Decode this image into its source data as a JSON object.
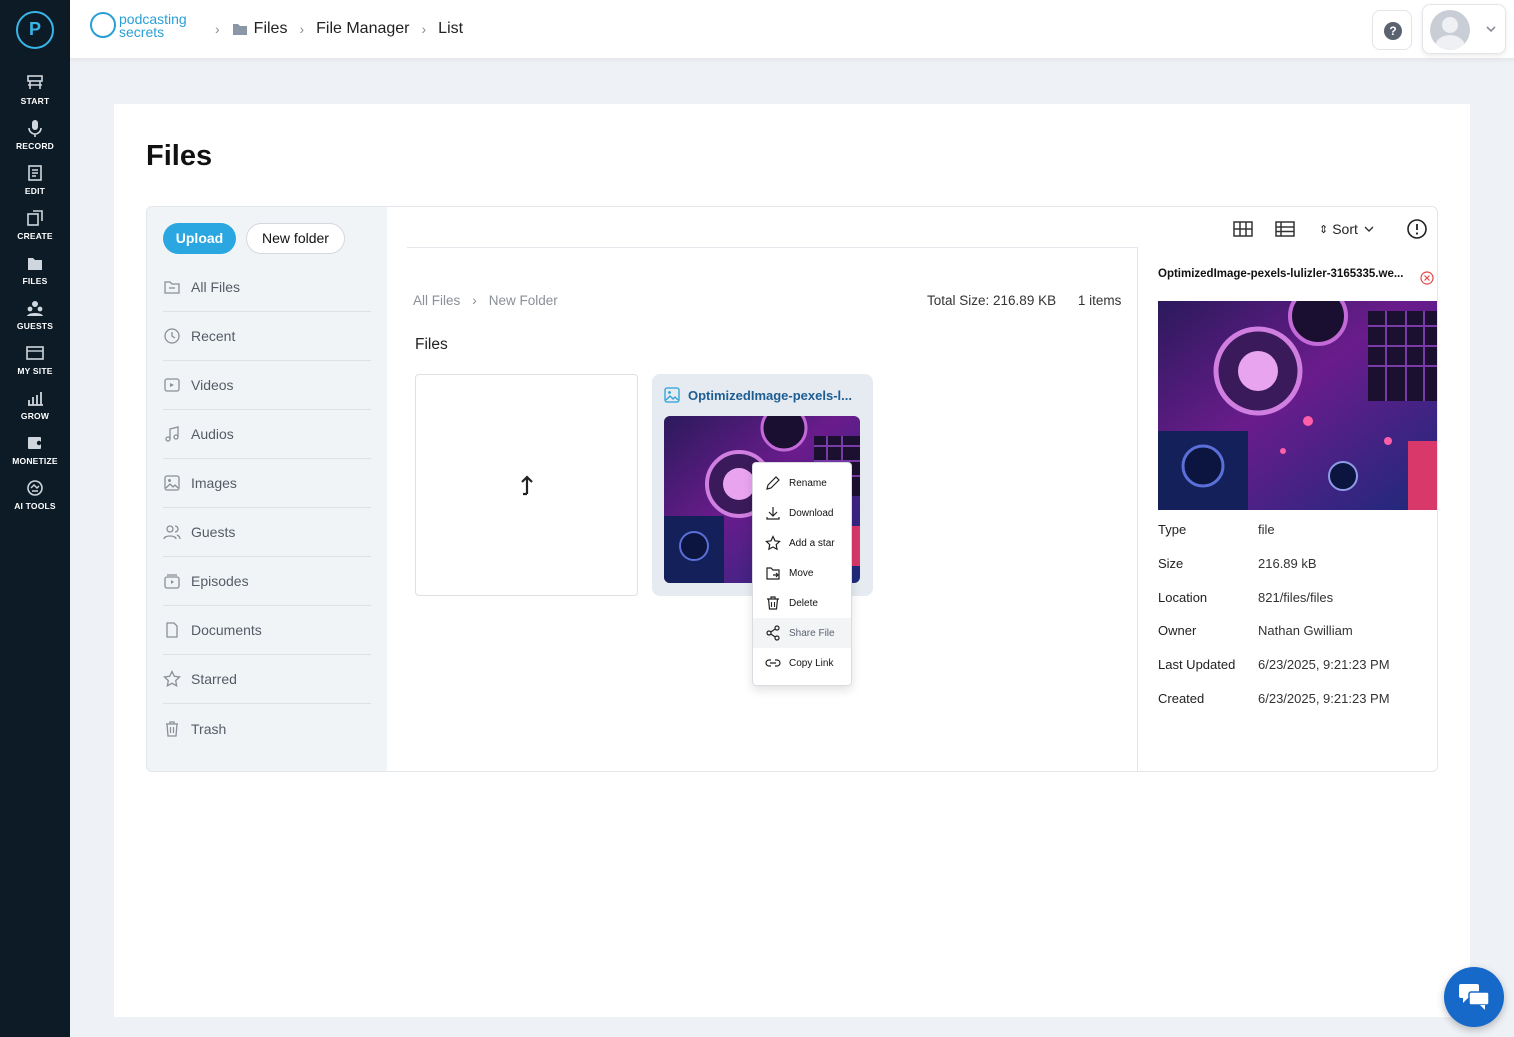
{
  "rail": {
    "logo_letter": "P",
    "items": [
      {
        "label": "START",
        "icon": "start-icon"
      },
      {
        "label": "RECORD",
        "icon": "microphone-icon"
      },
      {
        "label": "EDIT",
        "icon": "edit-icon"
      },
      {
        "label": "CREATE",
        "icon": "create-icon"
      },
      {
        "label": "FILES",
        "icon": "files-icon"
      },
      {
        "label": "GUESTS",
        "icon": "guests-icon"
      },
      {
        "label": "MY SITE",
        "icon": "my-site-icon"
      },
      {
        "label": "GROW",
        "icon": "grow-icon"
      },
      {
        "label": "MONETIZE",
        "icon": "monetize-icon"
      },
      {
        "label": "AI TOOLS",
        "icon": "ai-tools-icon"
      }
    ]
  },
  "header": {
    "brand_line1": "podcasting",
    "brand_line2": "secrets",
    "breadcrumb": [
      "Files",
      "File Manager",
      "List"
    ],
    "help_symbol": "?"
  },
  "page": {
    "title": "Files"
  },
  "sidebar": {
    "upload_label": "Upload",
    "new_folder_label": "New folder",
    "items": [
      {
        "label": "All Files",
        "icon": "folder-icon"
      },
      {
        "label": "Recent",
        "icon": "clock-icon"
      },
      {
        "label": "Videos",
        "icon": "video-icon"
      },
      {
        "label": "Audios",
        "icon": "music-icon"
      },
      {
        "label": "Images",
        "icon": "image-icon"
      },
      {
        "label": "Guests",
        "icon": "users-icon"
      },
      {
        "label": "Episodes",
        "icon": "episodes-icon"
      },
      {
        "label": "Documents",
        "icon": "document-icon"
      },
      {
        "label": "Starred",
        "icon": "star-icon"
      },
      {
        "label": "Trash",
        "icon": "trash-icon"
      }
    ]
  },
  "toolbar": {
    "sort_label": "Sort"
  },
  "location": {
    "path": [
      "All Files",
      "New Folder"
    ],
    "total_size": "Total Size: 216.89 KB",
    "items_count": "1 items",
    "section_label": "Files"
  },
  "file": {
    "name_truncated": "OptimizedImage-pexels-l...",
    "icon": "image-file-icon"
  },
  "context_menu": [
    {
      "label": "Rename",
      "icon": "pencil-icon"
    },
    {
      "label": "Download",
      "icon": "download-icon"
    },
    {
      "label": "Add a star",
      "icon": "star-icon"
    },
    {
      "label": "Move",
      "icon": "move-icon"
    },
    {
      "label": "Delete",
      "icon": "trash-icon"
    },
    {
      "label": "Share File",
      "icon": "share-icon"
    },
    {
      "label": "Copy Link",
      "icon": "link-icon"
    }
  ],
  "details": {
    "file_name": "OptimizedImage-pexels-lulizler-3165335.we...",
    "rows": [
      {
        "key": "Type",
        "value": "file"
      },
      {
        "key": "Size",
        "value": "216.89 kB"
      },
      {
        "key": "Location",
        "value": "821/files/files"
      },
      {
        "key": "Owner",
        "value": "Nathan Gwilliam"
      },
      {
        "key": "Last Updated",
        "value": "6/23/2025, 9:21:23 PM"
      },
      {
        "key": "Created",
        "value": "6/23/2025, 9:21:23 PM"
      }
    ]
  },
  "colors": {
    "accent": "#2aa6e0",
    "rail_bg": "#0d1b26",
    "chat_bg": "#1668c9",
    "close_red": "#e04848"
  }
}
